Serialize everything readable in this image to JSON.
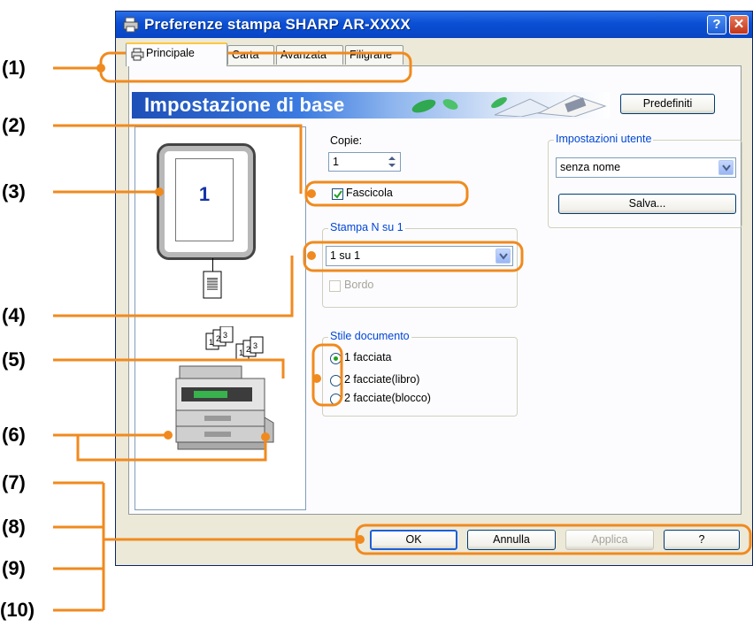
{
  "window": {
    "title": "Preferenze stampa SHARP AR-XXXX",
    "help_button": "?",
    "close_button": "✕"
  },
  "tabs": [
    {
      "label": "Principale",
      "active": true
    },
    {
      "label": "Carta",
      "active": false
    },
    {
      "label": "Avanzata",
      "active": false
    },
    {
      "label": "Filigrane",
      "active": false
    }
  ],
  "banner": {
    "title": "Impostazione di base"
  },
  "buttons": {
    "defaults": "Predefiniti",
    "save": "Salva...",
    "ok": "OK",
    "cancel": "Annulla",
    "apply": "Applica",
    "help": "?"
  },
  "preview": {
    "page_number": "1"
  },
  "copies": {
    "label": "Copie:",
    "value": "1"
  },
  "collate": {
    "label": "Fascicola",
    "checked": true
  },
  "user_settings": {
    "title": "Impostazioni utente",
    "selected": "senza nome"
  },
  "n_up": {
    "title": "Stampa N su 1",
    "selected": "1 su 1",
    "border_label": "Bordo",
    "border_checked": false
  },
  "document_style": {
    "title": "Stile documento",
    "options": [
      {
        "label": "1 facciata",
        "selected": true
      },
      {
        "label": "2 facciate(libro)",
        "selected": false
      },
      {
        "label": "2 facciate(blocco)",
        "selected": false
      }
    ]
  },
  "callouts": [
    "(1)",
    "(2)",
    "(3)",
    "(4)",
    "(5)",
    "(6)",
    "(7)",
    "(8)",
    "(9)",
    "(10)"
  ],
  "colors": {
    "callout_orange": "#f08a1e",
    "title_blue": "#0a4fd4",
    "accent_green": "#21a121"
  }
}
